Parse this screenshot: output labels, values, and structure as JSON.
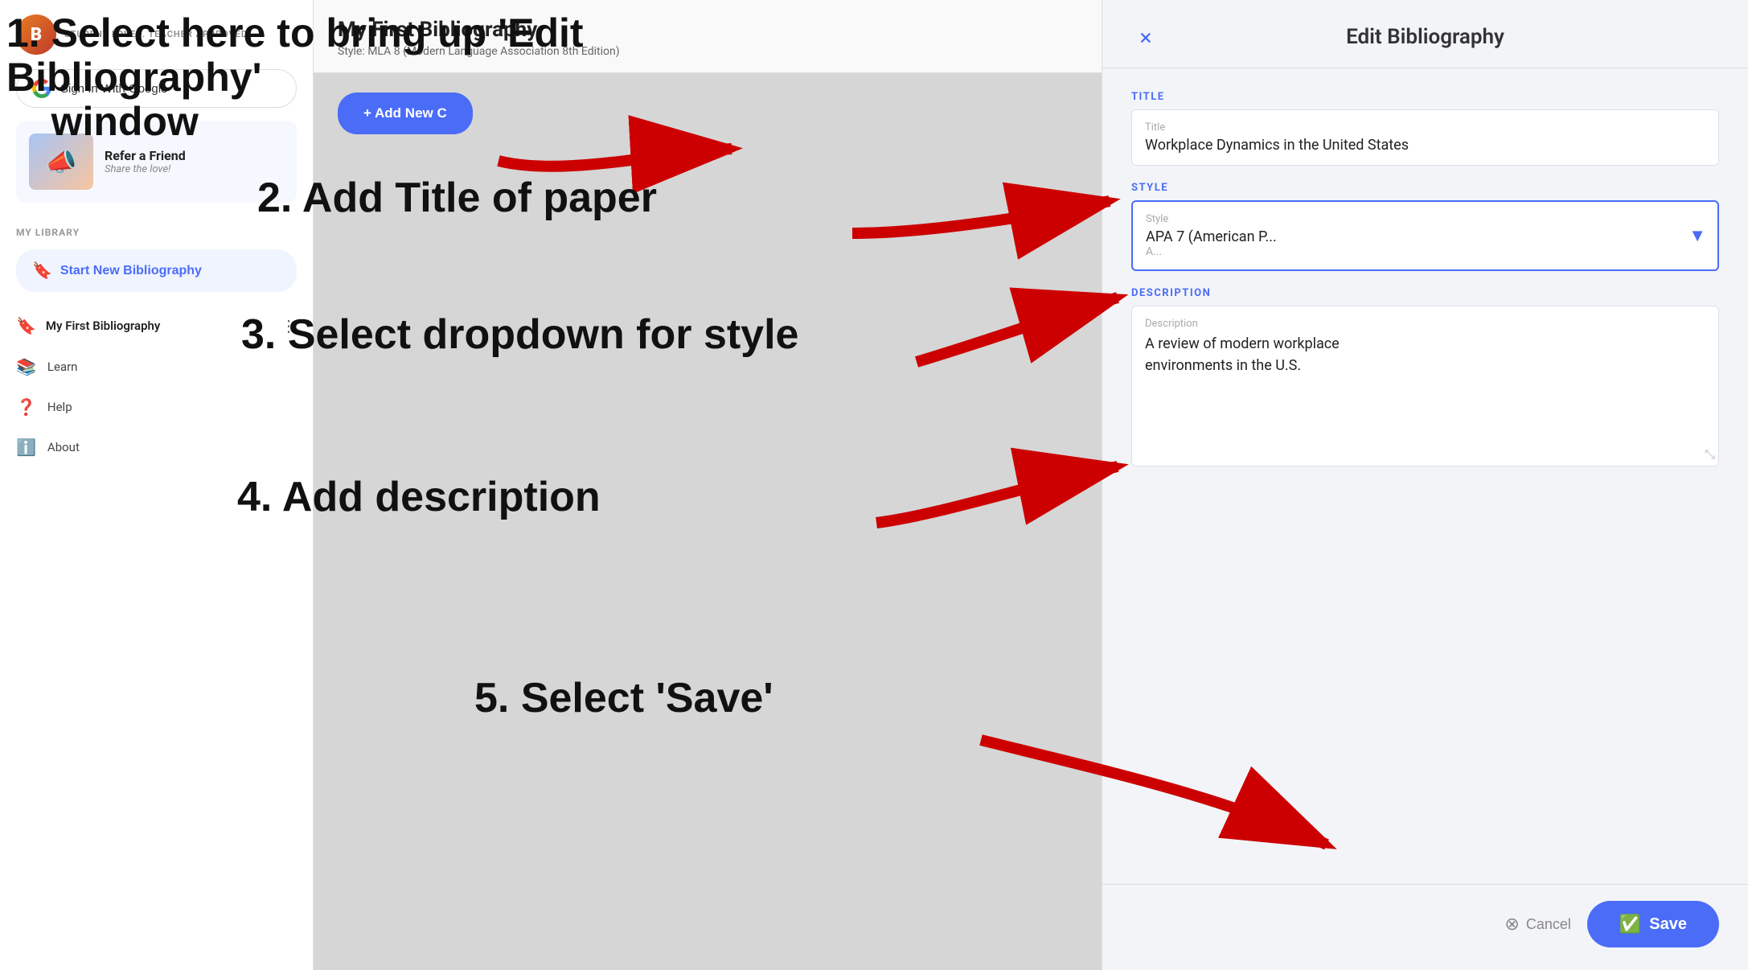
{
  "sidebar": {
    "logo_initial": "B",
    "logo_tagline": "Student Loved. Teacher Approved.",
    "signin_label": "Sign In With Google",
    "refer_title": "Refer a Friend",
    "refer_sub": "Share the love!",
    "refer_emoji": "📣",
    "section_label": "MY LIBRARY",
    "new_bib_label": "Start New Bibliography",
    "bib_item_name": "My First Bibliography",
    "nav_items": [
      {
        "icon": "📚",
        "label": "Learn"
      },
      {
        "icon": "❓",
        "label": "Help"
      },
      {
        "icon": "ℹ️",
        "label": "About"
      }
    ]
  },
  "main": {
    "bib_title": "My First Bibliography",
    "bib_style": "Style: MLA 8 (Modern Language Association 8th Edition)",
    "add_new_label": "+ Add New C"
  },
  "dialog": {
    "close_symbol": "×",
    "title": "Edit Bibliography",
    "title_section_label": "TITLE",
    "title_placeholder": "Title",
    "title_value": "Workplace Dynamics in the United States",
    "style_section_label": "STYLE",
    "style_placeholder": "Style",
    "style_value": "APA 7 (American P...",
    "style_value2": "A...",
    "description_section_label": "DESCRIPTION",
    "description_placeholder": "Description",
    "description_value": "A review of modern workplace\nenvironments in the U.S.",
    "cancel_label": "Cancel",
    "save_label": "Save"
  },
  "annotations": {
    "ann1": "1. Select here to bring up  'Edit Bibliography'\n    window",
    "ann2": "2.  Add Title of paper",
    "ann3": "3.  Select dropdown for style",
    "ann4": "4.  Add description",
    "ann5": "5.  Select 'Save'"
  }
}
